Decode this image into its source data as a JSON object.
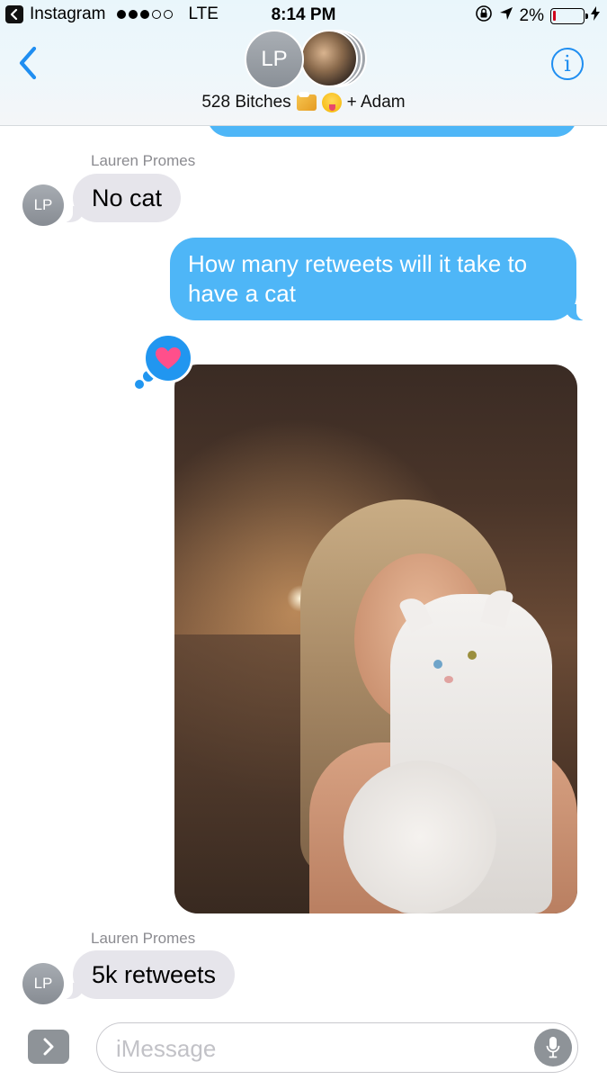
{
  "status_bar": {
    "back_app": "Instagram",
    "carrier": "LTE",
    "time": "8:14 PM",
    "battery": "2%",
    "battery_level": 0.02,
    "signal_bars_on": 3,
    "signal_bars_total": 5
  },
  "header": {
    "back_icon": "chevron-left-icon",
    "avatar_initials": "LP",
    "group_name": "528 Bitches",
    "group_name_suffix": "+ Adam",
    "info_label": "i"
  },
  "messages": [
    {
      "direction": "incoming",
      "sender": "Lauren Promes",
      "avatar": "LP",
      "text": "No cat"
    },
    {
      "direction": "outgoing",
      "text": "How many retweets will it take to have a cat"
    },
    {
      "direction": "outgoing",
      "type": "photo",
      "tapback": "heart-icon"
    },
    {
      "direction": "incoming",
      "sender": "Lauren Promes",
      "avatar": "LP",
      "text": "5k retweets"
    }
  ],
  "composer": {
    "placeholder": "iMessage",
    "apps_icon": "chevron-right-icon",
    "mic_icon": "microphone-icon"
  },
  "colors": {
    "imessage_blue": "#4eb6f7",
    "incoming_bubble": "#e6e5eb",
    "ios_link_blue": "#1f8ef1",
    "heart_pink": "#ff4f8b",
    "avatar_gray": "#8e9398"
  }
}
